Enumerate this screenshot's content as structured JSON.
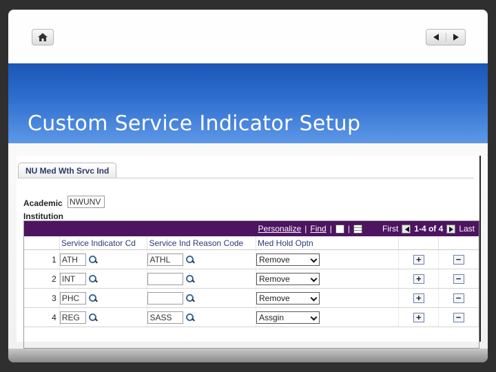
{
  "nav": {
    "home_icon": "home-icon",
    "prev_icon": "triangle-left-icon",
    "next_icon": "triangle-right-icon"
  },
  "banner": {
    "title": "Custom Service Indicator Setup",
    "color": "#2f6fd0"
  },
  "panel": {
    "tab_label": "NU Med Wth Srvc Ind",
    "academic_label_line1": "Academic",
    "academic_label_line2": "Institution",
    "academic_value": "NWUNV"
  },
  "grid": {
    "header_color": "#4d1462",
    "personalize": "Personalize",
    "find": "Find",
    "first": "First",
    "range": "1-4 of 4",
    "last": "Last",
    "columns": [
      "Service Indicator Cd",
      "Service Ind Reason Code",
      "Med Hold Optn"
    ],
    "rows": [
      {
        "num": "1",
        "indicator": "ATH",
        "reason": "ATHL",
        "hold": "Remove"
      },
      {
        "num": "2",
        "indicator": "INT",
        "reason": "",
        "hold": "Remove"
      },
      {
        "num": "3",
        "indicator": "PHC",
        "reason": "",
        "hold": "Remove"
      },
      {
        "num": "4",
        "indicator": "REG",
        "reason": "SASS",
        "hold": "Assgin"
      }
    ],
    "add_symbol": "+",
    "delete_symbol": "−"
  }
}
